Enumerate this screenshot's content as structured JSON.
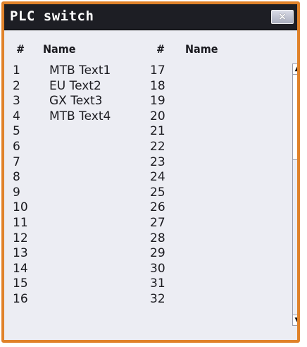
{
  "window": {
    "title": "PLC switch",
    "close_label": "×"
  },
  "columns": {
    "left": {
      "num_header": "#",
      "name_header": "Name"
    },
    "right": {
      "num_header": "#",
      "name_header": "Name"
    }
  },
  "left_rows": [
    {
      "num": "1",
      "name": "MTB Text1"
    },
    {
      "num": "2",
      "name": "EU Text2"
    },
    {
      "num": "3",
      "name": "GX Text3"
    },
    {
      "num": "4",
      "name": "MTB Text4"
    },
    {
      "num": "5",
      "name": ""
    },
    {
      "num": "6",
      "name": ""
    },
    {
      "num": "7",
      "name": ""
    },
    {
      "num": "8",
      "name": ""
    },
    {
      "num": "9",
      "name": ""
    },
    {
      "num": "10",
      "name": ""
    },
    {
      "num": "11",
      "name": ""
    },
    {
      "num": "12",
      "name": ""
    },
    {
      "num": "13",
      "name": ""
    },
    {
      "num": "14",
      "name": ""
    },
    {
      "num": "15",
      "name": ""
    },
    {
      "num": "16",
      "name": ""
    }
  ],
  "right_rows": [
    {
      "num": "17",
      "name": ""
    },
    {
      "num": "18",
      "name": ""
    },
    {
      "num": "19",
      "name": ""
    },
    {
      "num": "20",
      "name": ""
    },
    {
      "num": "21",
      "name": ""
    },
    {
      "num": "22",
      "name": ""
    },
    {
      "num": "23",
      "name": ""
    },
    {
      "num": "24",
      "name": ""
    },
    {
      "num": "25",
      "name": ""
    },
    {
      "num": "26",
      "name": ""
    },
    {
      "num": "27",
      "name": ""
    },
    {
      "num": "28",
      "name": ""
    },
    {
      "num": "29",
      "name": ""
    },
    {
      "num": "30",
      "name": ""
    },
    {
      "num": "31",
      "name": ""
    },
    {
      "num": "32",
      "name": ""
    }
  ],
  "scrollbar": {
    "up_glyph": "▲",
    "down_glyph": "▼"
  },
  "colors": {
    "frame_border": "#e0822a",
    "titlebar": "#1d1e24",
    "panel_bg": "#ecedf3"
  }
}
